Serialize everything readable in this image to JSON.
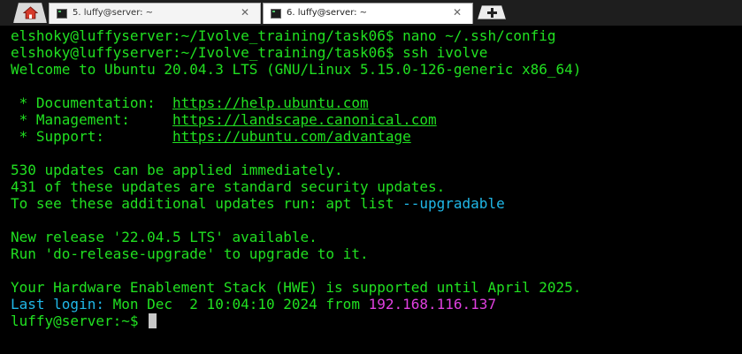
{
  "tabs": [
    {
      "label": "5. luffy@server: ~",
      "close": "✕",
      "active": false
    },
    {
      "label": "6. luffy@server: ~",
      "close": "✕",
      "active": true
    }
  ],
  "icons": {
    "home": "home-icon",
    "new_tab": "plus-icon",
    "terminal": "terminal-icon"
  },
  "colors": {
    "background": "#000000",
    "text": "#21e021",
    "cyan": "#20b8e8",
    "magenta": "#e040e0",
    "home_icon": "#d63a2a"
  },
  "terminal": {
    "cmd1_prompt": "elshoky@luffyserver:~/Ivolve_training/task06$ ",
    "cmd1_text": "nano ~/.ssh/config",
    "cmd2_prompt": "elshoky@luffyserver:~/Ivolve_training/task06$ ",
    "cmd2_text": "ssh ivolve",
    "welcome": "Welcome to Ubuntu 20.04.3 LTS (GNU/Linux 5.15.0-126-generic x86_64)",
    "doc_label": " * Documentation:  ",
    "doc_url": "https://help.ubuntu.com",
    "mgmt_label": " * Management:     ",
    "mgmt_url": "https://landscape.canonical.com",
    "support_label": " * Support:        ",
    "support_url": "https://ubuntu.com/advantage",
    "updates1": "530 updates can be applied immediately.",
    "updates2": "431 of these updates are standard security updates.",
    "updates3_text": "To see these additional updates run: apt list ",
    "updates3_flag": "--upgradable",
    "release1": "New release '22.04.5 LTS' available.",
    "release2": "Run 'do-release-upgrade' to upgrade to it.",
    "hwe": "Your Hardware Enablement Stack (HWE) is supported until April 2025.",
    "last_login_label": "Last login: ",
    "last_login_date": "Mon Dec  2 10:04:10 2024",
    "last_login_from": " from ",
    "last_login_ip": "192.168.116.137",
    "final_prompt": "luffy@server:~$ "
  }
}
